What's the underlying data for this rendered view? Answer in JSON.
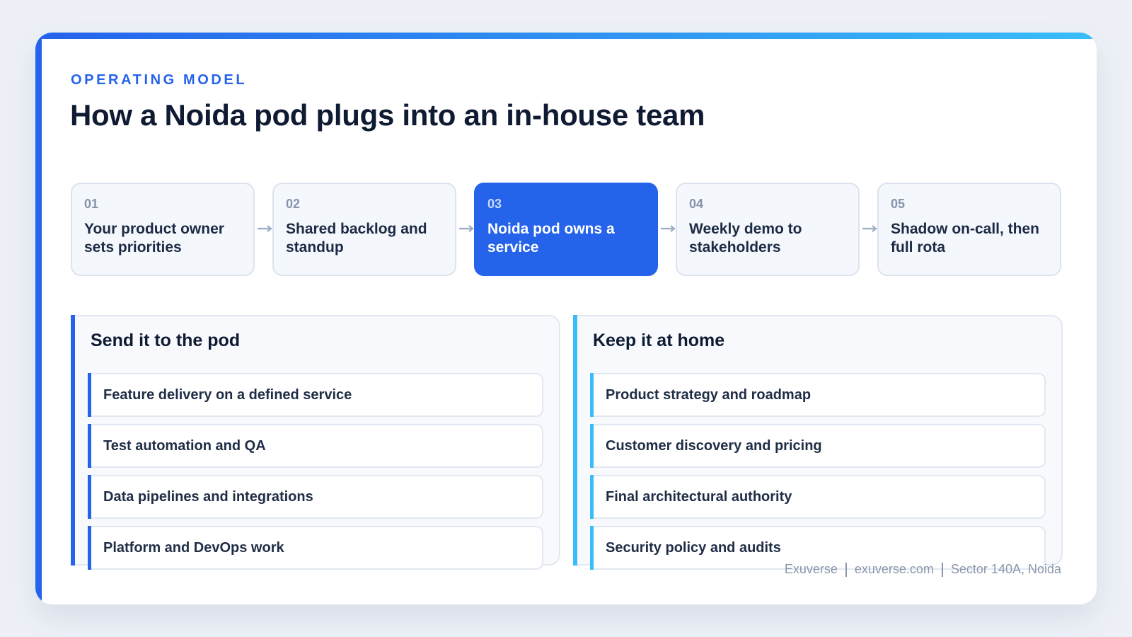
{
  "slide": {
    "eyebrow": "OPERATING MODEL",
    "title": "How a Noida pod plugs into an in-house team"
  },
  "colors": {
    "primary": "#2563eb",
    "secondary": "#38bdf8",
    "title_text": "#0f1b33",
    "muted_text": "#8a97ab"
  },
  "steps": [
    {
      "num": "01",
      "label": "Your product owner sets priorities",
      "active": false
    },
    {
      "num": "02",
      "label": "Shared backlog and standup",
      "active": false
    },
    {
      "num": "03",
      "label": "Noida pod owns a service",
      "active": true
    },
    {
      "num": "04",
      "label": "Weekly demo to stakeholders",
      "active": false
    },
    {
      "num": "05",
      "label": "Shadow on-call, then full rota",
      "active": false
    }
  ],
  "connector_icon": "arrow-right-icon",
  "panels": {
    "pod": {
      "title": "Send it to the pod",
      "items": [
        "Feature delivery on a defined service",
        "Test automation and QA",
        "Data pipelines and integrations",
        "Platform and DevOps work"
      ]
    },
    "home": {
      "title": "Keep it at home",
      "items": [
        "Product strategy and roadmap",
        "Customer discovery and pricing",
        "Final architectural authority",
        "Security policy and audits"
      ]
    }
  },
  "footer": {
    "brand": "Exuverse",
    "website": "exuverse.com",
    "location": "Sector 140A, Noida"
  }
}
